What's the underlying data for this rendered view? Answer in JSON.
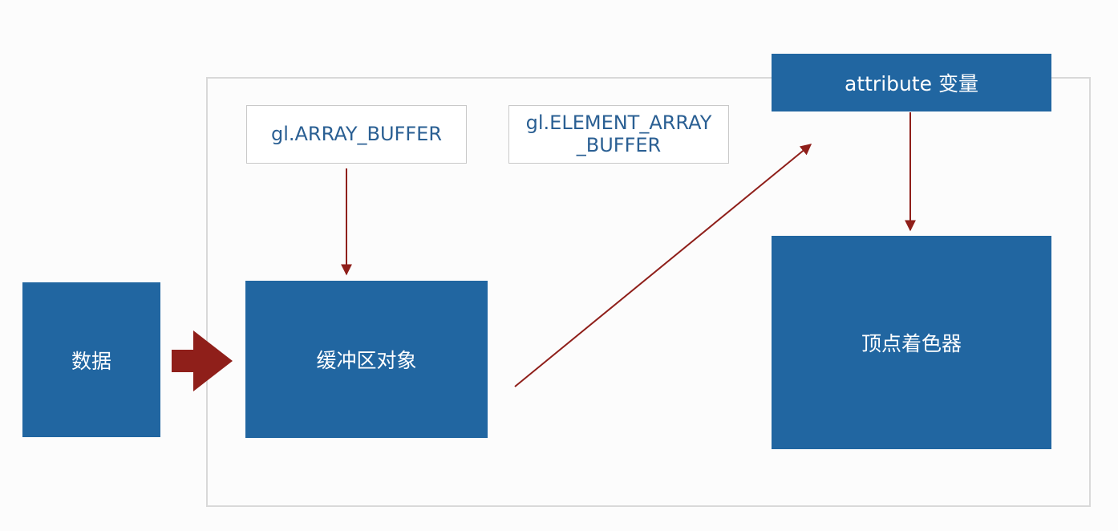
{
  "nodes": {
    "data": "数据",
    "buffer_object": "缓冲区对象",
    "array_buffer": "gl.ARRAY_BUFFER",
    "element_array_buffer_line1": "gl.ELEMENT_ARRAY",
    "element_array_buffer_line2": "_BUFFER",
    "attribute_variable": "attribute 变量",
    "vertex_shader": "顶点着色器"
  },
  "colors": {
    "node_fill": "#2166a1",
    "node_text": "#ffffff",
    "label_text": "#2a5f93",
    "arrow": "#8f1f1a",
    "frame_border": "#d9d9d9"
  }
}
